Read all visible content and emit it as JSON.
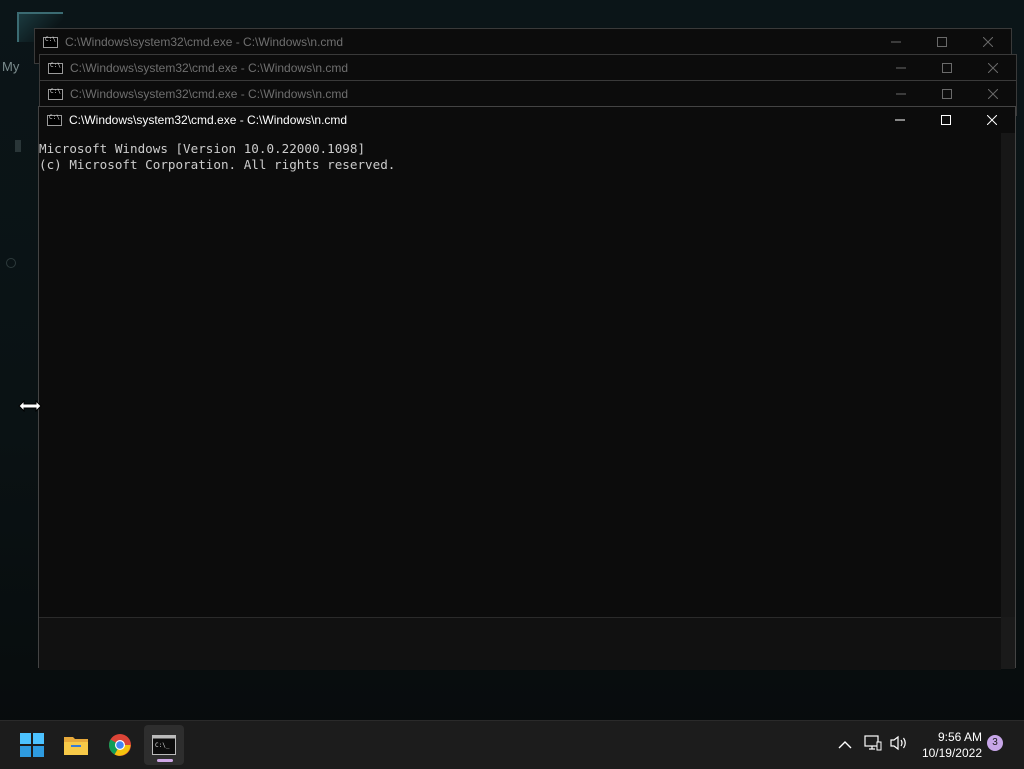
{
  "desktop": {
    "label_text": "My"
  },
  "windows": [
    {
      "title": "C:\\Windows\\system32\\cmd.exe - C:\\Windows\\n.cmd"
    },
    {
      "title": "C:\\Windows\\system32\\cmd.exe - C:\\Windows\\n.cmd"
    },
    {
      "title": "C:\\Windows\\system32\\cmd.exe - C:\\Windows\\n.cmd"
    },
    {
      "title": "C:\\Windows\\system32\\cmd.exe - C:\\Windows\\n.cmd"
    }
  ],
  "console": {
    "lines": [
      "Microsoft Windows [Version 10.0.22000.1098]",
      "(c) Microsoft Corporation. All rights reserved."
    ]
  },
  "taskbar": {
    "apps": [
      "start-icon",
      "file-explorer-icon",
      "chrome-icon",
      "cmd-icon"
    ],
    "clock_time": "9:56 AM",
    "clock_date": "10/19/2022",
    "notification_count": "3"
  },
  "colors": {
    "console_bg": "#0c0c0c",
    "console_text": "#cccccc",
    "taskbar_bg": "#1c1c1c",
    "badge": "#c7a6e8"
  }
}
